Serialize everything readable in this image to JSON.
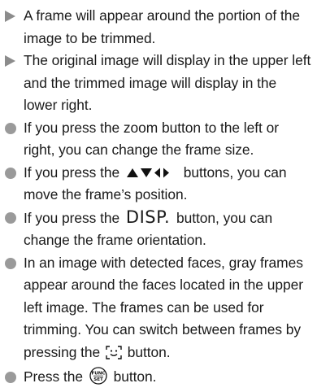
{
  "items": [
    {
      "marker": "triangle-bullet-icon",
      "text": "A frame will appear around the portion of the image to be trimmed."
    },
    {
      "marker": "triangle-bullet-icon",
      "text": "The original image will display in the upper left and the trimmed image will display in the lower right."
    },
    {
      "marker": "circle-bullet-icon",
      "text": "If you press the zoom button to the left or right, you can change the frame size."
    },
    {
      "marker": "circle-bullet-icon",
      "text_before": "If you press the",
      "icon": "up-down-left-right-arrows-icon",
      "text_after": "buttons, you can move the frame’s position."
    },
    {
      "marker": "circle-bullet-icon",
      "text_before": "If you press the",
      "disp_label": "DISP.",
      "text_after": "button, you can change the frame orientation."
    },
    {
      "marker": "circle-bullet-icon",
      "text_before": "In an image with detected faces, gray frames appear around the faces located in the upper left image. The frames can be used for trimming. You can switch between frames by pressing the",
      "icon": "face-select-icon",
      "text_after": "button."
    },
    {
      "marker": "circle-bullet-icon",
      "text_before": "Press the",
      "icon": "func-set-icon",
      "icon_label_top": "FUNC",
      "icon_label_bottom": "SET",
      "text_after": "button."
    }
  ],
  "colors": {
    "bullet": "#9a9a9a",
    "triangle": "#8c8c8c",
    "text": "#1a1a1a"
  }
}
